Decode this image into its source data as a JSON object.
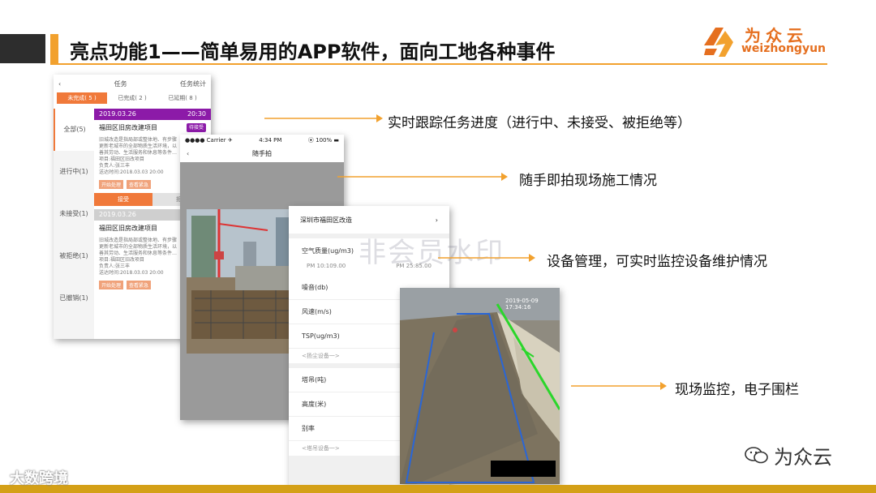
{
  "header": {
    "title": "亮点功能1——简单易用的APP软件，面向工地各种事件"
  },
  "logo": {
    "cn": "为众云",
    "en": "weizhongyun"
  },
  "watermarks": {
    "center": "非会员水印",
    "bottom_left": "大数跨境",
    "bottom_right": "为众云"
  },
  "features": [
    "实时跟踪任务进度（进行中、未接受、被拒绝等）",
    "随手即拍现场施工情况",
    "设备管理，可实时监控设备维护情况",
    "现场监控，电子围栏"
  ],
  "task_app": {
    "back": "‹",
    "title": "任务",
    "stats": "任务统计",
    "tabs": [
      "未完成( 5 )",
      "已完成( 2 )",
      "已延期( 8 )"
    ],
    "sidebar": [
      "全部(5)",
      "进行中(1)",
      "未接受(1)",
      "被拒绝(1)",
      "已撤销(1)"
    ],
    "card1": {
      "date": "2019.03.26",
      "time": "20:30",
      "name": "福田区旧房改建项目",
      "badge": "待接受",
      "desc1": "旧城改造是指局部或整体地、有步骤",
      "desc2": "更新老城市的全部物质生活环境，以",
      "desc3": "善其劳动、生活服务和休息等条件…",
      "project": "项目:福田区旧改项目",
      "owner": "负责人:张三丰",
      "sent": "送达时间:2018.03.03 20:00",
      "btn1": "开始处理",
      "btn2": "查看紧急",
      "accept": "接受",
      "reject": "拒绝"
    },
    "card2": {
      "date": "2019.03.26",
      "name": "福田区旧房改建项目",
      "desc1": "旧城改造是指局部或整体地、有步骤",
      "desc2": "更新老城市的全部物质生活环境，以",
      "desc3": "善其劳动、生活服务和休息等条件…",
      "project": "项目:福田区旧改项目",
      "owner": "负责人:张三丰",
      "sent": "送达时间:2018.03.03 20:00",
      "btn1": "开始处理",
      "btn2": "查看紧急"
    }
  },
  "camera_app": {
    "carrier": "●●●● Carrier ✈",
    "time": "4:34 PM",
    "battery": "⦿ 100% ▬",
    "back": "‹",
    "title": "随手拍"
  },
  "device_app": {
    "location": "深圳市福田区改造",
    "chevron": "›",
    "air_quality": "空气质量(ug/m3)",
    "pm_left": "PM 10:109.00",
    "pm_right": "PM 25:85.00",
    "noise": "噪音(db)",
    "wind": "风速(m/s)",
    "tsp": "TSP(ug/m3)",
    "dust_hint": "<扬尘设备一>",
    "crane": "塔吊(吨)",
    "height": "高度(米)",
    "ratio": "别率",
    "crane_hint": "<塔吊设备一>"
  },
  "monitor": {
    "timestamp": "2019-05-09 17:34:16"
  }
}
